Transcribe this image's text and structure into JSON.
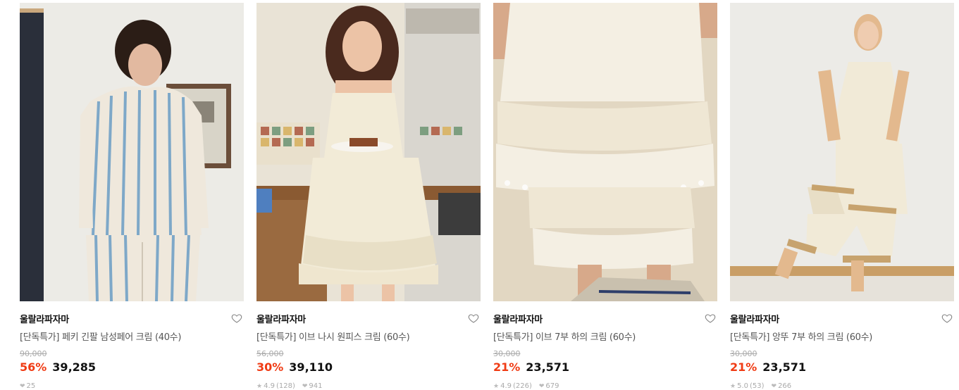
{
  "products": [
    {
      "brand": "울랄라파자마",
      "title": "[단독특가] 페키 긴팔 남성페어 크림 (40수)",
      "original_price": "90,000",
      "discount": "56%",
      "price": "39,285",
      "rating": "",
      "reviews": "",
      "likes": "25",
      "image_alt": "Man in blue and cream striped long-sleeve pajama set"
    },
    {
      "brand": "울랄라파자마",
      "title": "[단독특가] 이브 나시 원피스 크림 (60수)",
      "original_price": "56,000",
      "discount": "30%",
      "price": "39,110",
      "rating": "4.9",
      "reviews": "(128)",
      "likes": "941",
      "image_alt": "Woman in cream ruffled sleeveless night dress in kitchen"
    },
    {
      "brand": "울랄라파자마",
      "title": "[단독특가] 이브 7부 하의 크림 (60수)",
      "original_price": "30,000",
      "discount": "21%",
      "price": "23,571",
      "rating": "4.9",
      "reviews": "(226)",
      "likes": "679",
      "image_alt": "Close-up of cream ruffled lace-trimmed cropped pants"
    },
    {
      "brand": "울랄라파자마",
      "title": "[단독특가] 앙뚜 7부 하의 크림 (60수)",
      "original_price": "30,000",
      "discount": "21%",
      "price": "23,571",
      "rating": "5.0",
      "reviews": "(53)",
      "likes": "266",
      "image_alt": "Woman in cream camisole dress and ruffled cropped pants"
    }
  ],
  "icons": {
    "like": "heart-outline-icon",
    "star": "star-icon",
    "likes_count": "heart-filled-icon"
  },
  "colors": {
    "discount": "#f03b14",
    "text": "#111111",
    "muted": "#aaaaaa"
  }
}
